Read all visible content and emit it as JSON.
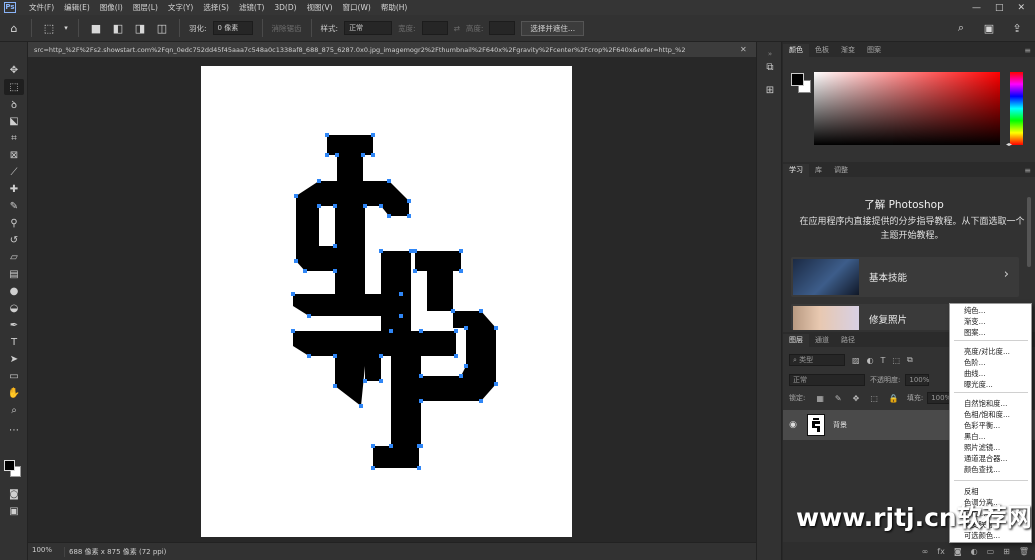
{
  "menubar": {
    "items": [
      "文件(F)",
      "编辑(E)",
      "图像(I)",
      "图层(L)",
      "文字(Y)",
      "选择(S)",
      "滤镜(T)",
      "3D(D)",
      "视图(V)",
      "窗口(W)",
      "帮助(H)"
    ],
    "controls": [
      "—",
      "□",
      "✕"
    ]
  },
  "options": {
    "feather_label": "羽化:",
    "feather_value": "0 像素",
    "antialias_label": "消除锯齿",
    "style_label": "样式:",
    "style_value": "正常",
    "width_label": "宽度:",
    "height_label": "高度:",
    "select_subject": "选择并遮住..."
  },
  "document": {
    "tab_title": "src=http_%2F%2Fs2.showstart.com%2Fqn_0edc752dd45f45aaa7c548a0c1338af8_688_875_6287.0x0.jpg_imagemogr2%2Fthumbnail%2F640x%2Fgravity%2Fcenter%2Fcrop%2F640x&refer=http_%2",
    "zoom": "100%",
    "info": "688 像素 x 875 像素 (72 ppi)"
  },
  "color_panel": {
    "tabs": [
      "颜色",
      "色板",
      "渐变",
      "图案"
    ]
  },
  "learn_panel": {
    "tabs": [
      "学习",
      "库",
      "调整"
    ],
    "title": "了解 Photoshop",
    "description": "在应用程序内直接提供的分步指导教程。从下面选取一个主题开始教程。",
    "cards": [
      {
        "label": "基本技能"
      },
      {
        "label": "修复照片"
      }
    ]
  },
  "layers_panel": {
    "tabs": [
      "图层",
      "通道",
      "路径"
    ],
    "kind_filter": "类型",
    "blend_mode": "正常",
    "opacity_label": "不透明度:",
    "opacity_value": "100%",
    "lock_label": "锁定:",
    "fill_label": "填充:",
    "fill_value": "100%",
    "layer_name": "背景"
  },
  "adjustment_menu": {
    "groups": [
      [
        "纯色...",
        "渐变...",
        "图案..."
      ],
      [
        "亮度/对比度...",
        "色阶...",
        "曲线...",
        "曝光度..."
      ],
      [
        "自然饱和度...",
        "色相/饱和度...",
        "色彩平衡...",
        "黑白...",
        "照片滤镜...",
        "通道混合器...",
        "颜色查找..."
      ],
      [
        "反相",
        "色调分离...",
        "阈值...",
        "渐变映射...",
        "可选颜色..."
      ]
    ]
  },
  "watermark": "www.rjtj.cn软荐网"
}
